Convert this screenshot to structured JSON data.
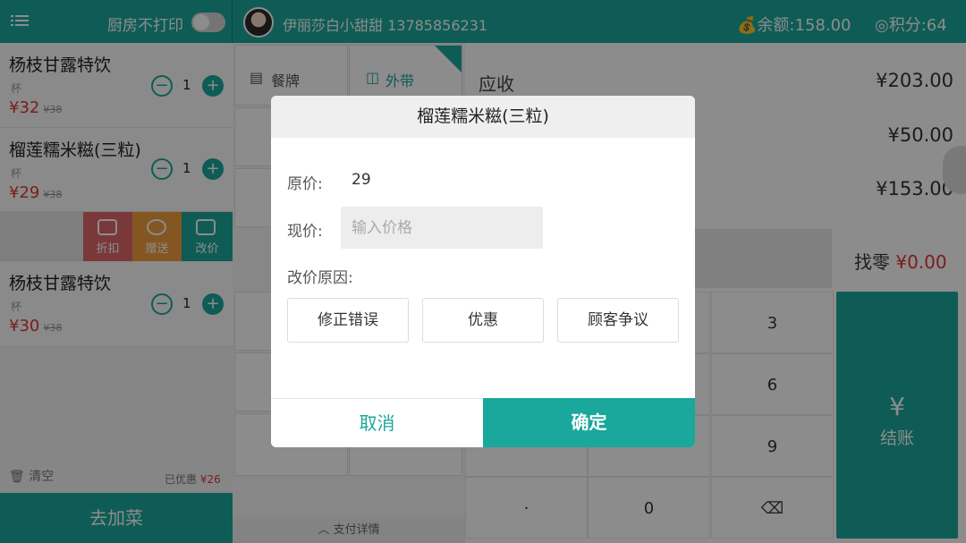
{
  "colors": {
    "accent": "#1aa89c",
    "price_red": "#e23535"
  },
  "topbar": {
    "kitchen_label": "厨房不打印",
    "user": "伊丽莎白小甜甜 13785856231",
    "balance": "余额:158.00",
    "points": "积分:64"
  },
  "cart": {
    "items": [
      {
        "name": "杨枝甘露特饮",
        "unit": "杯",
        "price": "¥32",
        "orig": "¥38",
        "qty": "1"
      },
      {
        "name": "榴莲糯米糍(三粒)",
        "unit": "杯",
        "price": "¥29",
        "orig": "¥38",
        "qty": "1"
      },
      {
        "name": "杨枝甘露特饮",
        "unit": "杯",
        "price": "¥30",
        "orig": "¥38",
        "qty": "1"
      }
    ],
    "actions": {
      "discount": "折扣",
      "gift": "赠送",
      "reprice": "改价"
    },
    "clear": "清空",
    "saved_label": "已优惠",
    "saved_value": "¥26",
    "add_dish": "去加菜"
  },
  "middle": {
    "tab_plate": "餐牌",
    "tab_takeout": "外带",
    "pay_detail": "支付详情"
  },
  "summary": {
    "receivable_label": "应收",
    "receivable": "¥203.00",
    "discount": "¥50.00",
    "paid": "¥153.00",
    "change_label": "找零",
    "change": "¥0.00"
  },
  "keypad": {
    "k3": "3",
    "k6": "6",
    "k9": "9",
    "k0": "0",
    "kdot": "·",
    "checkout": "结账"
  },
  "dialog": {
    "title": "榴莲糯米糍(三粒)",
    "orig_label": "原价:",
    "orig_value": "29",
    "now_label": "现价:",
    "now_placeholder": "输入价格",
    "reason_label": "改价原因:",
    "reasons": [
      "修正错误",
      "优惠",
      "顾客争议"
    ],
    "cancel": "取消",
    "ok": "确定"
  }
}
